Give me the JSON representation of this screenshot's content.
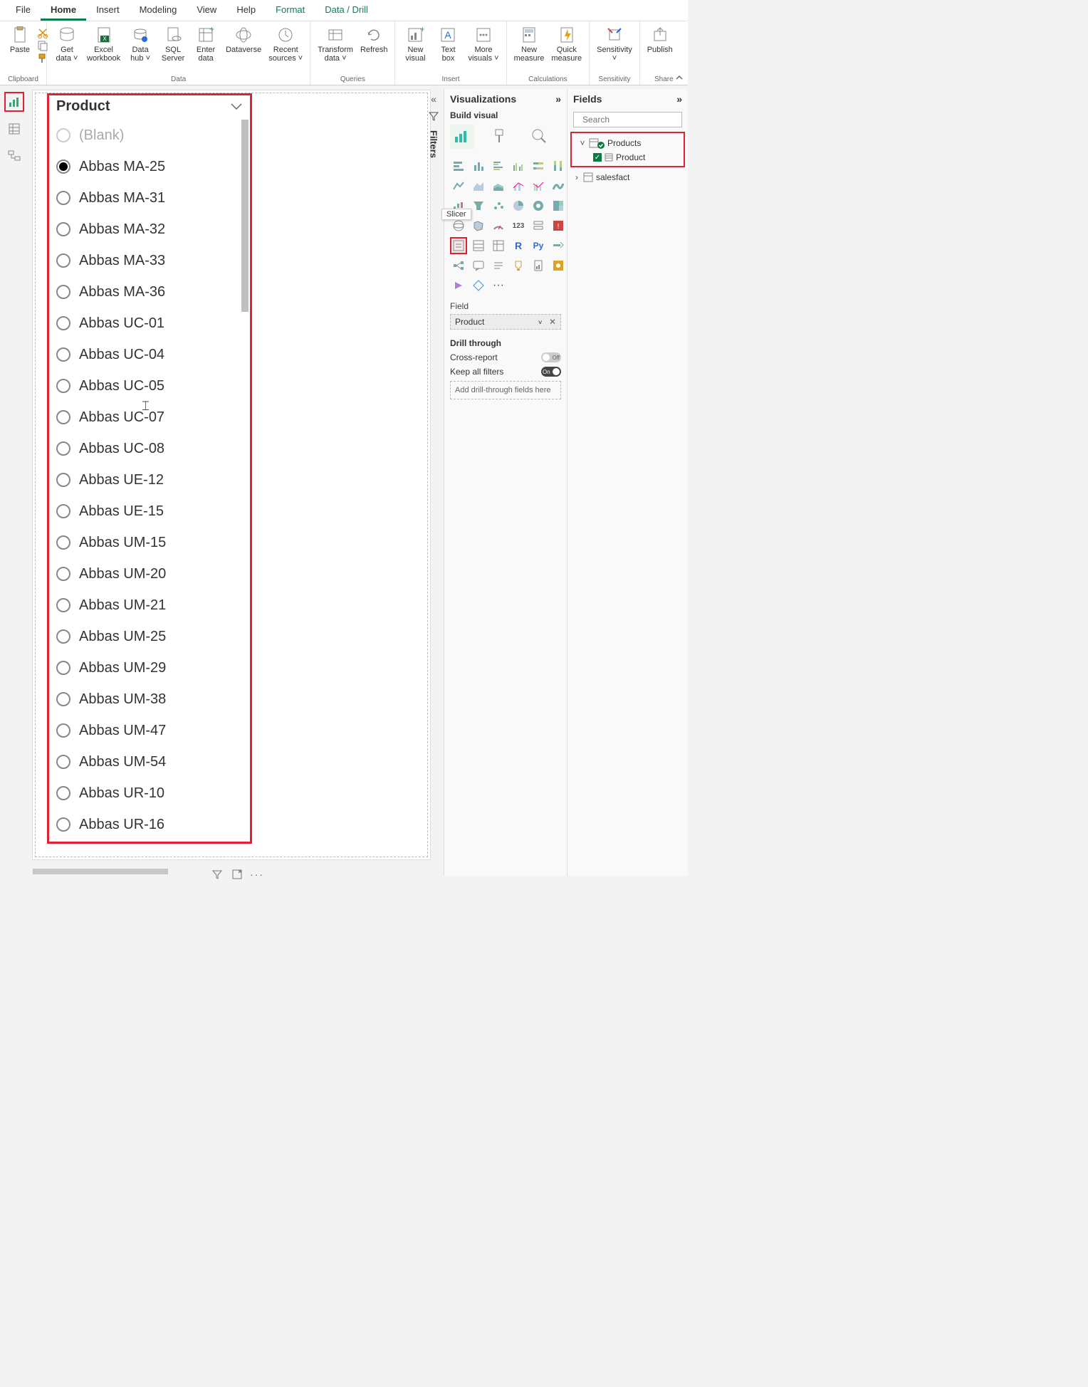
{
  "ribbon": {
    "tabs": [
      "File",
      "Home",
      "Insert",
      "Modeling",
      "View",
      "Help",
      "Format",
      "Data / Drill"
    ],
    "active_tab": "Home",
    "groups": {
      "clipboard": {
        "title": "Clipboard",
        "paste": "Paste"
      },
      "data": {
        "title": "Data",
        "get_data": "Get\ndata ˅",
        "excel": "Excel\nworkbook",
        "hub": "Data\nhub ˅",
        "sql": "SQL\nServer",
        "enter": "Enter\ndata",
        "dataverse": "Dataverse",
        "recent": "Recent\nsources ˅"
      },
      "queries": {
        "title": "Queries",
        "transform": "Transform\ndata ˅",
        "refresh": "Refresh"
      },
      "insert": {
        "title": "Insert",
        "visual": "New\nvisual",
        "textbox": "Text\nbox",
        "more": "More\nvisuals ˅"
      },
      "calc": {
        "title": "Calculations",
        "measure": "New\nmeasure",
        "quick": "Quick\nmeasure"
      },
      "sens": {
        "title": "Sensitivity",
        "label": "Sensitivity\n˅"
      },
      "share": {
        "title": "Share",
        "publish": "Publish"
      }
    }
  },
  "filters_label": "Filters",
  "viz_pane": {
    "title": "Visualizations",
    "subtitle": "Build visual",
    "tooltip": "Slicer",
    "field_label": "Field",
    "field_value": "Product",
    "drill_title": "Drill through",
    "cross": "Cross-report",
    "keep": "Keep all filters",
    "drop": "Add drill-through fields here"
  },
  "fields_pane": {
    "title": "Fields",
    "search_placeholder": "Search",
    "table1": "Products",
    "table1_field": "Product",
    "table2": "salesfact"
  },
  "slicer": {
    "title": "Product",
    "items": [
      {
        "label": "(Blank)",
        "blank": true,
        "selected": false
      },
      {
        "label": "Abbas MA-25",
        "selected": true
      },
      {
        "label": "Abbas MA-31"
      },
      {
        "label": "Abbas MA-32"
      },
      {
        "label": "Abbas MA-33"
      },
      {
        "label": "Abbas MA-36"
      },
      {
        "label": "Abbas UC-01"
      },
      {
        "label": "Abbas UC-04"
      },
      {
        "label": "Abbas UC-05"
      },
      {
        "label": "Abbas UC-07"
      },
      {
        "label": "Abbas UC-08"
      },
      {
        "label": "Abbas UE-12"
      },
      {
        "label": "Abbas UE-15"
      },
      {
        "label": "Abbas UM-15"
      },
      {
        "label": "Abbas UM-20"
      },
      {
        "label": "Abbas UM-21"
      },
      {
        "label": "Abbas UM-25"
      },
      {
        "label": "Abbas UM-29"
      },
      {
        "label": "Abbas UM-38"
      },
      {
        "label": "Abbas UM-47"
      },
      {
        "label": "Abbas UM-54"
      },
      {
        "label": "Abbas UR-10"
      },
      {
        "label": "Abbas UR-16"
      }
    ]
  }
}
